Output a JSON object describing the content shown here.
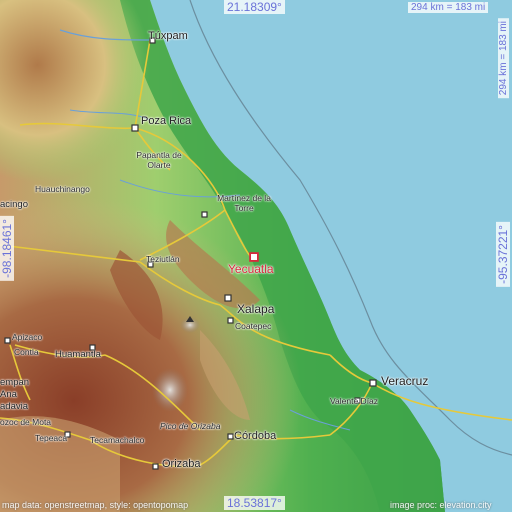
{
  "map": {
    "colors": {
      "sea": "#8fcbe0",
      "lowland": "#3fa64a",
      "plain": "#8dcc6a",
      "hills": "#d9c48a",
      "mountain": "#a05a3a",
      "peak": "#d8d4d0",
      "road": "#e6c93a",
      "highlight": "#d8283c"
    },
    "coords": {
      "top": "21.18309°",
      "bottom": "18.53817°",
      "left": "-98.18461°",
      "right": "-95.37221°"
    },
    "scale": {
      "top": "294 km = 183 mi",
      "right": "294 km = 183 mi"
    },
    "highlight": "Yecuatla",
    "cities": {
      "tuxpam": "Túxpam",
      "poza_rica": "Poza Rica",
      "papantla": "Papantla de Olarte",
      "huauchinango": "Huauchinango",
      "martinez": "Martínez de la Torre",
      "teziutlan": "Teziutlán",
      "xalapa": "Xalapa",
      "coatepec": "Coatepec",
      "apizaco": "Apizaco",
      "contla": "Contla",
      "huamantla": "Huamantla",
      "veracruz": "Veracruz",
      "valente": "Valente Díaz",
      "pico": "Pico de Orizaba",
      "cordoba": "Córdoba",
      "tepeaca": "Tepeaca",
      "tecamachalco": "Tecamachalco",
      "orizaba": "Orizaba",
      "acingo": "acingo",
      "empan": "empan",
      "ana": "Ana",
      "adavia": "adavia",
      "ozoc": "ozoc de Mota"
    },
    "attribution": {
      "left": "map data: openstreetmap, style: opentopomap",
      "right": "image proc: elevation.city"
    }
  }
}
